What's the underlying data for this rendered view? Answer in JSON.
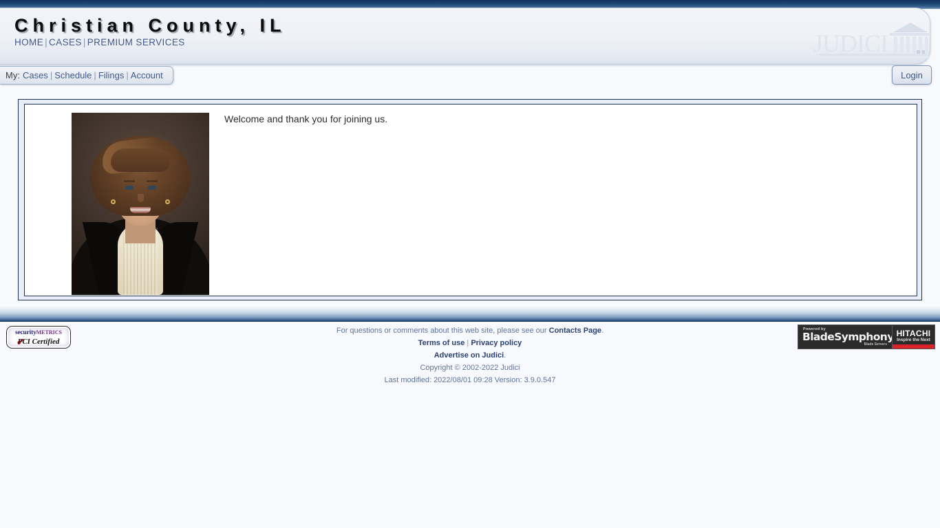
{
  "header": {
    "county_title": "Christian County, IL",
    "nav": [
      {
        "label": "HOME"
      },
      {
        "label": "CASES"
      },
      {
        "label": "PREMIUM SERVICES"
      }
    ],
    "separator": "|",
    "logo_text": "JUDICI",
    "logo_icon": "courthouse-icon"
  },
  "mybar": {
    "prefix": "My:",
    "items": [
      {
        "label": "Cases"
      },
      {
        "label": "Schedule"
      },
      {
        "label": "Filings"
      },
      {
        "label": "Account"
      }
    ],
    "separator": "|",
    "login_label": "Login"
  },
  "main": {
    "portrait_alt": "county-official-portrait",
    "welcome_text": "Welcome and thank you for joining us."
  },
  "footer": {
    "contact_line_prefix": "For questions or comments about this web site, please see our ",
    "contacts_link": "Contacts Page",
    "contact_line_suffix": ".",
    "terms_link": "Terms of use",
    "separator": "|",
    "privacy_link": "Privacy policy",
    "advertise_link": "Advertise on Judici",
    "advertise_suffix": ".",
    "copyright": "Copyright © 2002-2022 Judici",
    "last_modified": "Last modified: 2022/08/01 09:28 Version: 3.9.0.547",
    "pci_badge": {
      "line1_a": "security",
      "line1_b": "METRICS",
      "line2": "PCI Certified",
      "check": "✔"
    },
    "hitachi_badge": {
      "powered_by": "Powered by",
      "product": "BladeSymphony",
      "product_sub": "Blade Servers",
      "brand": "HITACHI",
      "tagline": "Inspire the Next"
    }
  },
  "colors": {
    "navy": "#13345e",
    "link_blue": "#41598a",
    "page_bg": "#f8f9fc",
    "border_navy": "#1b3252",
    "inner_fill": "#eaeefb",
    "hitachi_red": "#d8232a"
  }
}
